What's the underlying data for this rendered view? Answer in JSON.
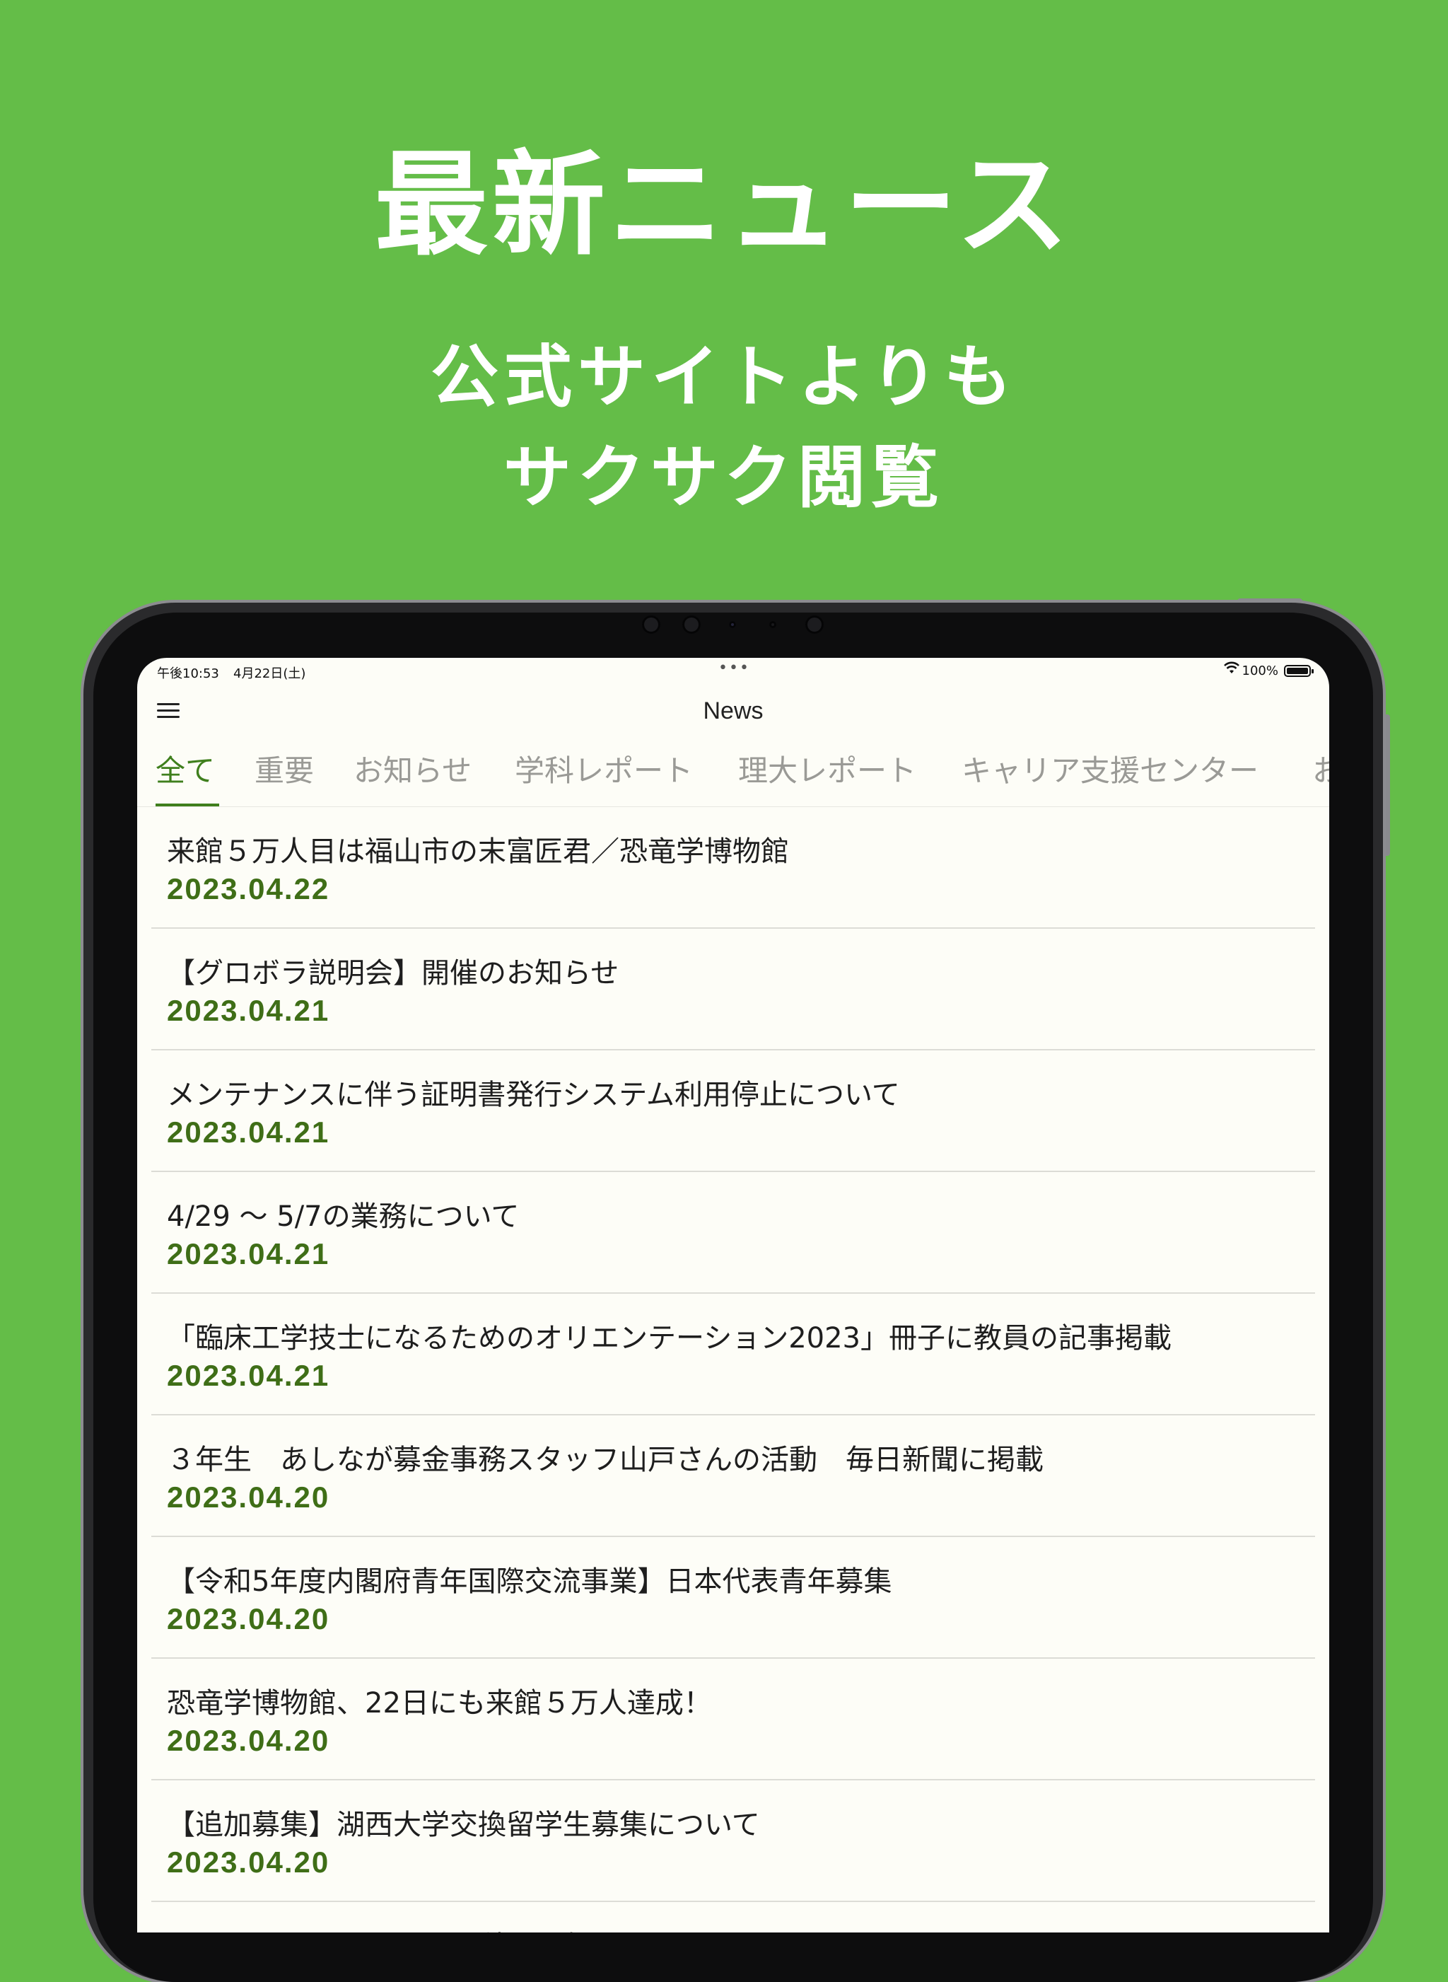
{
  "promo": {
    "title": "最新ニュース",
    "subtitle_line1": "公式サイトよりも",
    "subtitle_line2": "サクサク閲覧"
  },
  "status_bar": {
    "time": "午後10:53",
    "date": "4月22日(土)",
    "dots": "•••",
    "battery": "100%"
  },
  "nav": {
    "title": "News"
  },
  "tabs": [
    {
      "label": "全て",
      "selected": true
    },
    {
      "label": "重要"
    },
    {
      "label": "お知らせ"
    },
    {
      "label": "学科レポート"
    },
    {
      "label": "理大レポート"
    },
    {
      "label": "キャリア支援センター"
    },
    {
      "label": "お"
    }
  ],
  "news": [
    {
      "title": "来館５万人目は福山市の末富匠君／恐竜学博物館",
      "date": "2023.04.22"
    },
    {
      "title": "【グロボラ説明会】開催のお知らせ",
      "date": "2023.04.21"
    },
    {
      "title": "メンテナンスに伴う証明書発行システム利用停止について",
      "date": "2023.04.21"
    },
    {
      "title": "4/29 ～ 5/7の業務について",
      "date": "2023.04.21"
    },
    {
      "title": "「臨床工学技士になるためのオリエンテーション2023」冊子に教員の記事掲載",
      "date": "2023.04.21"
    },
    {
      "title": "３年生　あしなが募金事務スタッフ山戸さんの活動　毎日新聞に掲載",
      "date": "2023.04.20"
    },
    {
      "title": "【令和5年度内閣府青年国際交流事業】日本代表青年募集",
      "date": "2023.04.20"
    },
    {
      "title": "恐竜学博物館、22日にも来館５万人達成！",
      "date": "2023.04.20"
    },
    {
      "title": "【追加募集】湖西大学交換留学生募集について",
      "date": "2023.04.20"
    },
    {
      "title": "Lunch Break English開催のお知らせ",
      "date": ""
    }
  ],
  "colors": {
    "background": "#64bd48",
    "accent": "#3f7f1d",
    "date": "#3f6e17"
  }
}
